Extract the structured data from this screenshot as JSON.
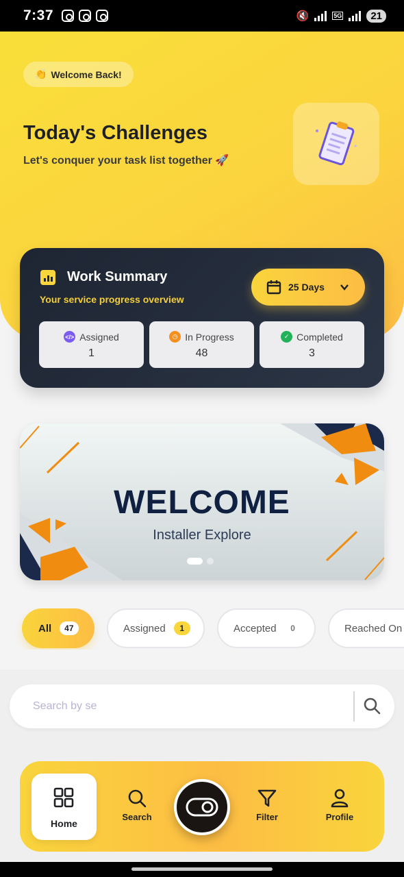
{
  "status_bar": {
    "time": "7:37",
    "network": "5G",
    "battery": "21"
  },
  "hero": {
    "welcome": "Welcome Back!",
    "welcome_emoji": "👏",
    "title": "Today's Challenges",
    "subtitle": "Let's conquer your task list together 🚀"
  },
  "summary": {
    "title": "Work Summary",
    "subtitle": "Your service progress overview",
    "days_label": "25 Days",
    "stats": [
      {
        "label": "Assigned",
        "value": "1",
        "color": "#7c5cf0"
      },
      {
        "label": "In Progress",
        "value": "48",
        "color": "#f5901f"
      },
      {
        "label": "Completed",
        "value": "3",
        "color": "#22b35a"
      }
    ]
  },
  "banner": {
    "title": "WELCOME",
    "subtitle": "Installer Explore",
    "slide": 1,
    "slides": 2
  },
  "filters": [
    {
      "label": "All",
      "count": "47",
      "active": true
    },
    {
      "label": "Assigned",
      "count": "1",
      "active": false
    },
    {
      "label": "Accepted",
      "count": "0",
      "active": false
    },
    {
      "label": "Reached On S",
      "count": "",
      "active": false
    }
  ],
  "search": {
    "placeholder": "Search by se"
  },
  "nav": {
    "items": [
      {
        "label": "Home",
        "icon": "grid-icon",
        "active": true
      },
      {
        "label": "Search",
        "icon": "search-icon",
        "active": false
      },
      {
        "label": "Filter",
        "icon": "filter-icon",
        "active": false
      },
      {
        "label": "Profile",
        "icon": "user-icon",
        "active": false
      }
    ],
    "center_icon": "toggle-icon"
  },
  "colors": {
    "accent": "#f9d63c",
    "accent_2": "#fdbd44",
    "dark": "#1e2533"
  }
}
